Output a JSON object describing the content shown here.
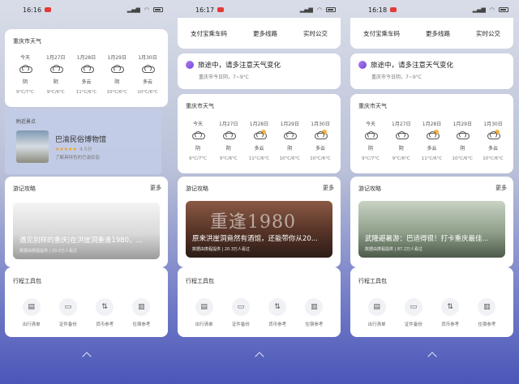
{
  "panels": [
    {
      "status": {
        "time": "16:16"
      },
      "weather": {
        "header": "重庆市天气",
        "days": [
          {
            "day": "今天",
            "cond": "阴",
            "temp": "9°C/7°C"
          },
          {
            "day": "1月27日",
            "cond": "阴",
            "temp": "9°C/6°C"
          },
          {
            "day": "1月28日",
            "cond": "多云",
            "temp": "11°C/6°C"
          },
          {
            "day": "1月29日",
            "cond": "阴",
            "temp": "10°C/6°C"
          },
          {
            "day": "1月30日",
            "cond": "多云",
            "temp": "10°C/6°C"
          }
        ]
      },
      "poi": {
        "label": "附近景点",
        "name": "巴渝民俗博物馆",
        "stars": "★★★★★",
        "score": "4.5分",
        "desc": "了解具特色的巴渝民俗"
      },
      "guides": {
        "header": "游记攻略",
        "more": "更多",
        "title": "遇见别样的重庆|在洪崖洞重逢1980，...",
        "meta": "数据由携程提供 | 20.0万人看过"
      },
      "tools": {
        "header": "行程工具包",
        "items": [
          {
            "icon": "▤",
            "label": "出行清单"
          },
          {
            "icon": "▭",
            "label": "证件备份"
          },
          {
            "icon": "⇅",
            "label": "货币参考"
          },
          {
            "icon": "▥",
            "label": "住宿参考"
          }
        ]
      }
    },
    {
      "status": {
        "time": "16:17"
      },
      "links": [
        "支付宝乘车码",
        "更多线路",
        "实时公交"
      ],
      "notice": {
        "title": "旅途中，请多注意天气变化",
        "sub": "重庆市今日阴，7~9°C"
      },
      "weather": {
        "header": "重庆市天气",
        "days": [
          {
            "day": "今天",
            "cond": "阴",
            "temp": "9°C/7°C"
          },
          {
            "day": "1月27日",
            "cond": "阴",
            "temp": "9°C/6°C"
          },
          {
            "day": "1月28日",
            "cond": "多云",
            "temp": "11°C/6°C"
          },
          {
            "day": "1月29日",
            "cond": "阴",
            "temp": "10°C/6°C"
          },
          {
            "day": "1月30日",
            "cond": "多云",
            "temp": "10°C/6°C"
          }
        ]
      },
      "guides": {
        "header": "游记攻略",
        "more": "更多",
        "bigtext": "重逢1980",
        "title": "原来洪崖洞竟然有酒馆，还能带你从20...",
        "meta": "数据由携程提供 | 20.3万人看过"
      },
      "tools": {
        "header": "行程工具包",
        "items": [
          {
            "icon": "▤",
            "label": "出行清单"
          },
          {
            "icon": "▭",
            "label": "证件备份"
          },
          {
            "icon": "⇅",
            "label": "货币参考"
          },
          {
            "icon": "▥",
            "label": "住宿参考"
          }
        ]
      }
    },
    {
      "status": {
        "time": "16:18"
      },
      "links": [
        "支付宝乘车码",
        "更多线路",
        "实时公交"
      ],
      "notice": {
        "title": "旅途中，请多注意天气变化",
        "sub": "重庆市今日阴，7~9°C"
      },
      "weather": {
        "header": "重庆市天气",
        "days": [
          {
            "day": "今天",
            "cond": "阴",
            "temp": "9°C/7°C"
          },
          {
            "day": "1月27日",
            "cond": "阴",
            "temp": "9°C/6°C"
          },
          {
            "day": "1月28日",
            "cond": "多云",
            "temp": "11°C/6°C"
          },
          {
            "day": "1月29日",
            "cond": "阴",
            "temp": "10°C/6°C"
          },
          {
            "day": "1月30日",
            "cond": "多云",
            "temp": "10°C/6°C"
          }
        ]
      },
      "guides": {
        "header": "游记攻略",
        "more": "更多",
        "title": "武隆避暑游：巴适得很！打卡重庆最佳...",
        "meta": "数据由携程提供 | 87.2万人看过"
      },
      "tools": {
        "header": "行程工具包",
        "items": [
          {
            "icon": "▤",
            "label": "出行清单"
          },
          {
            "icon": "▭",
            "label": "证件备份"
          },
          {
            "icon": "⇅",
            "label": "货币参考"
          },
          {
            "icon": "▥",
            "label": "住宿参考"
          }
        ]
      }
    }
  ]
}
